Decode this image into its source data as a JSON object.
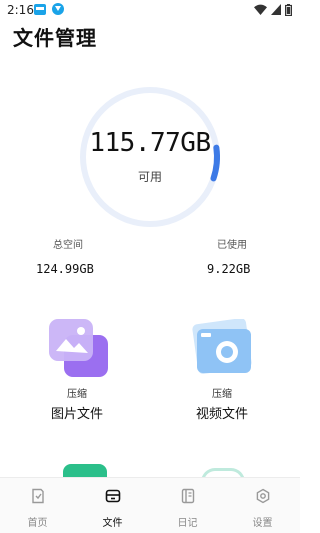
{
  "status_bar": {
    "time": "2:16"
  },
  "page": {
    "title": "文件管理"
  },
  "storage": {
    "available": "115.77GB",
    "available_label": "可用",
    "used_fraction": 0.074
  },
  "stats": [
    {
      "label": "总空间",
      "value": "124.99GB"
    },
    {
      "label": "已使用",
      "value": "9.22GB"
    }
  ],
  "tiles": [
    {
      "sub": "压缩",
      "title": "图片文件",
      "icon": "image-gallery-icon"
    },
    {
      "sub": "压缩",
      "title": "视频文件",
      "icon": "camera-photo-icon"
    }
  ],
  "nav": [
    {
      "label": "首页",
      "icon": "home-doc-icon",
      "active": false
    },
    {
      "label": "文件",
      "icon": "folder-icon",
      "active": true
    },
    {
      "label": "日记",
      "icon": "notebook-icon",
      "active": false
    },
    {
      "label": "设置",
      "icon": "gear-icon",
      "active": false
    }
  ],
  "colors": {
    "accent": "#3d7ae6",
    "ring_track": "#e9effa",
    "purple": "#a98bf0",
    "sky": "#8fc3f5"
  }
}
